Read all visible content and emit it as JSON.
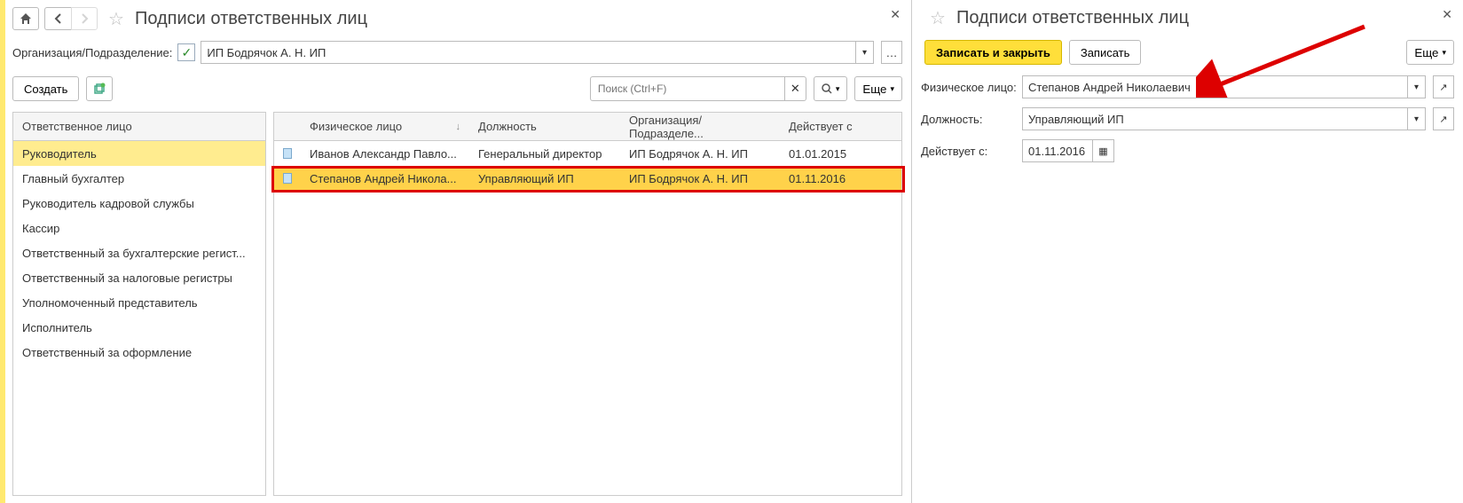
{
  "left": {
    "title": "Подписи ответственных лиц",
    "org_label": "Организация/Подразделение:",
    "org_value": "ИП Бодрячок А. Н. ИП",
    "create_btn": "Создать",
    "search_placeholder": "Поиск (Ctrl+F)",
    "more_btn": "Еще",
    "list_header": "Ответственное лицо",
    "list_items": [
      "Руководитель",
      "Главный бухгалтер",
      "Руководитель кадровой службы",
      "Кассир",
      "Ответственный за бухгалтерские регист...",
      "Ответственный за налоговые регистры",
      "Уполномоченный представитель",
      "Исполнитель",
      "Ответственный за оформление"
    ],
    "cols": {
      "person": "Физическое лицо",
      "position": "Должность",
      "org": "Организация/Подразделе...",
      "date": "Действует с"
    },
    "rows": [
      {
        "person": "Иванов Александр Павло...",
        "position": "Генеральный директор",
        "org": "ИП Бодрячок А. Н. ИП",
        "date": "01.01.2015"
      },
      {
        "person": "Степанов Андрей Никола...",
        "position": "Управляющий ИП",
        "org": "ИП Бодрячок А. Н. ИП",
        "date": "01.11.2016"
      }
    ]
  },
  "right": {
    "title": "Подписи ответственных лиц",
    "save_close": "Записать и закрыть",
    "save": "Записать",
    "more_btn": "Еще",
    "person_label": "Физическое лицо:",
    "person_value": "Степанов Андрей Николаевич",
    "position_label": "Должность:",
    "position_value": "Управляющий ИП",
    "date_label": "Действует с:",
    "date_value": "01.11.2016"
  }
}
